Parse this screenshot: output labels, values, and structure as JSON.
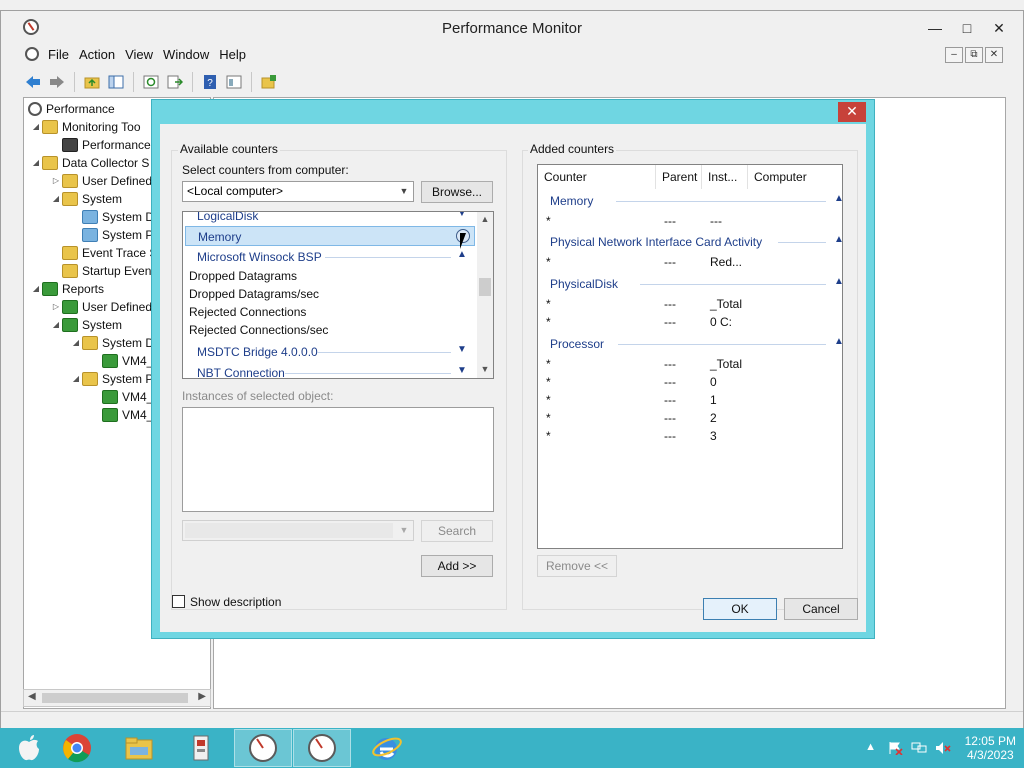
{
  "window": {
    "title": "Performance Monitor",
    "minimize": "—",
    "maximize": "□",
    "close": "✕"
  },
  "menu": {
    "items": [
      "File",
      "Action",
      "View",
      "Window",
      "Help"
    ]
  },
  "mdi": {
    "minimize": "–",
    "restore": "⧉",
    "close": "✕"
  },
  "tree": {
    "items": [
      {
        "label": "Performance"
      },
      {
        "label": "Monitoring Too"
      },
      {
        "label": "Performance"
      },
      {
        "label": "Data Collector S"
      },
      {
        "label": "User Defined"
      },
      {
        "label": "System"
      },
      {
        "label": "System D"
      },
      {
        "label": "System P"
      },
      {
        "label": "Event Trace S"
      },
      {
        "label": "Startup Even"
      },
      {
        "label": "Reports"
      },
      {
        "label": "User Defined"
      },
      {
        "label": "System"
      },
      {
        "label": "System D"
      },
      {
        "label": "VM4_"
      },
      {
        "label": "System P"
      },
      {
        "label": "VM4_"
      },
      {
        "label": "VM4_"
      }
    ]
  },
  "dialog": {
    "close": "✕",
    "available_counters": "Available counters",
    "select_from_computer": "Select counters from computer:",
    "computer_value": "<Local computer>",
    "browse": "Browse...",
    "counter_list": {
      "categories_top": [
        {
          "label": "LogicalDisk"
        },
        {
          "label": "Memory"
        },
        {
          "label": "Microsoft Winsock BSP"
        }
      ],
      "counters": [
        "Dropped Datagrams",
        "Dropped Datagrams/sec",
        "Rejected Connections",
        "Rejected Connections/sec"
      ],
      "categories_bottom": [
        {
          "label": "MSDTC Bridge 4.0.0.0"
        },
        {
          "label": "NBT Connection"
        }
      ]
    },
    "instances_label": "Instances of selected object:",
    "search": "Search",
    "add": "Add >>",
    "added_counters": "Added counters",
    "columns": {
      "counter": "Counter",
      "parent": "Parent",
      "instance": "Inst...",
      "computer": "Computer"
    },
    "added": {
      "memory": {
        "name": "Memory",
        "rows": [
          {
            "counter": "*",
            "parent": "---",
            "instance": "---"
          }
        ]
      },
      "nic": {
        "name": "Physical Network Interface Card Activity",
        "rows": [
          {
            "counter": "*",
            "parent": "---",
            "instance": "Red..."
          }
        ]
      },
      "disk": {
        "name": "PhysicalDisk",
        "rows": [
          {
            "counter": "*",
            "parent": "---",
            "instance": "_Total"
          },
          {
            "counter": "*",
            "parent": "---",
            "instance": "0 C:"
          }
        ]
      },
      "cpu": {
        "name": "Processor",
        "rows": [
          {
            "counter": "*",
            "parent": "---",
            "instance": "_Total"
          },
          {
            "counter": "*",
            "parent": "---",
            "instance": "0"
          },
          {
            "counter": "*",
            "parent": "---",
            "instance": "1"
          },
          {
            "counter": "*",
            "parent": "---",
            "instance": "2"
          },
          {
            "counter": "*",
            "parent": "---",
            "instance": "3"
          }
        ]
      }
    },
    "remove": "Remove <<",
    "show_description": "Show description",
    "ok": "OK",
    "cancel": "Cancel"
  },
  "taskbar": {
    "time": "12:05 PM",
    "date": "4/3/2023"
  },
  "colors": {
    "dialog_frame": "#6fd6e2",
    "taskbar": "#3ab3c6",
    "category_text": "#1e3e8a",
    "close_red": "#c7423a"
  }
}
